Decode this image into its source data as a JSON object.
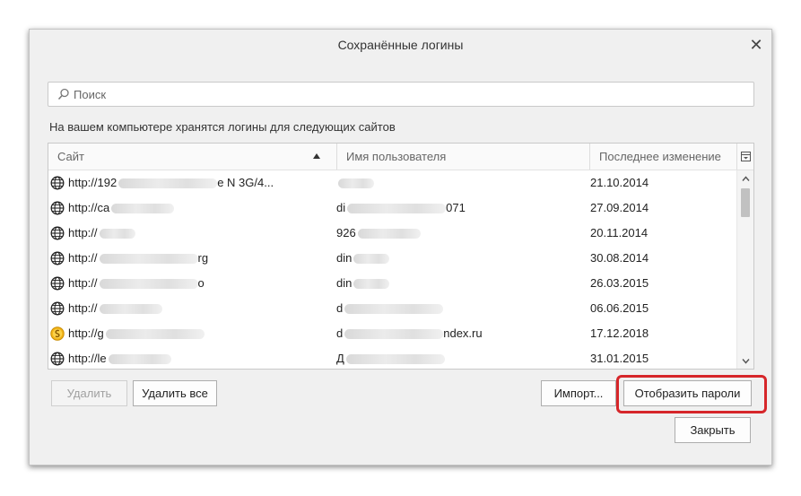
{
  "window": {
    "title": "Сохранённые логины",
    "close_glyph": "✕"
  },
  "search": {
    "placeholder": "Поиск",
    "value": ""
  },
  "info_text": "На вашем компьютере хранятся логины для следующих сайтов",
  "table": {
    "columns": {
      "site": "Сайт",
      "username": "Имя пользователя",
      "changed": "Последнее изменение"
    },
    "sort": {
      "column": "site",
      "direction": "ascending"
    },
    "rows": [
      {
        "site": "http://192",
        "site_suffix": "e N 3G/4...",
        "username": "",
        "date": "21.10.2014",
        "icon": "globe-icon"
      },
      {
        "site": "http://ca",
        "site_suffix": "",
        "username": "di",
        "username_suffix": "071",
        "date": "27.09.2014",
        "icon": "globe-icon"
      },
      {
        "site": "http://",
        "site_suffix": "",
        "username": "926",
        "username_suffix": "",
        "date": "20.11.2014",
        "icon": "globe-icon"
      },
      {
        "site": "http://",
        "site_suffix": "rg",
        "username": "din",
        "username_suffix": "",
        "date": "30.08.2014",
        "icon": "globe-icon"
      },
      {
        "site": "http://",
        "site_suffix": "o",
        "username": "din",
        "username_suffix": "",
        "date": "26.03.2015",
        "icon": "globe-icon"
      },
      {
        "site": "http://",
        "site_suffix": "",
        "username": "d",
        "username_suffix": "",
        "date": "06.06.2015",
        "icon": "globe-icon"
      },
      {
        "site": "http://g",
        "site_suffix": "",
        "username": "d",
        "username_suffix": "ndex.ru",
        "date": "17.12.2018",
        "icon": "yandex-coin-icon"
      },
      {
        "site": "http://le",
        "site_suffix": "",
        "username": "Д",
        "username_suffix": "",
        "date": "31.01.2015",
        "icon": "globe-icon"
      }
    ]
  },
  "buttons": {
    "remove": "Удалить",
    "remove_all": "Удалить все",
    "import": "Импорт...",
    "show_passwords": "Отобразить пароли",
    "close": "Закрыть"
  },
  "colors": {
    "highlight": "#d6262a"
  }
}
